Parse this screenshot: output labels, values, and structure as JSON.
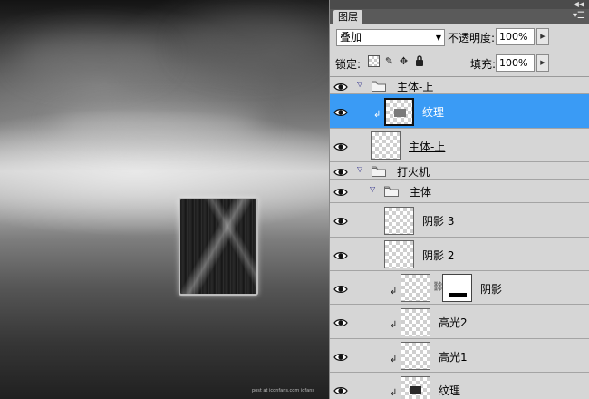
{
  "canvas": {
    "watermark": "post at iconfans.com  idfans"
  },
  "panel": {
    "tab_label": "图层",
    "blend_mode": "叠加",
    "opacity_label": "不透明度:",
    "opacity_value": "100%",
    "lock_label": "锁定:",
    "fill_label": "填充:",
    "fill_value": "100%"
  },
  "layers": [
    {
      "name": "主体-上",
      "kind": "group",
      "indent": 0,
      "expanded": true
    },
    {
      "name": "纹理",
      "kind": "layer",
      "indent": 1,
      "clipped": true,
      "selected": true
    },
    {
      "name": "主体-上",
      "kind": "layer",
      "indent": 0,
      "underlined": true
    },
    {
      "name": "打火机",
      "kind": "group",
      "indent": 0,
      "expanded": true
    },
    {
      "name": "主体",
      "kind": "group",
      "indent": 1,
      "expanded": true
    },
    {
      "name": "阴影 3",
      "kind": "layer",
      "indent": 1
    },
    {
      "name": "阴影 2",
      "kind": "layer",
      "indent": 1
    },
    {
      "name": "阴影",
      "kind": "layer",
      "indent": 2,
      "clipped": true,
      "has_mask": true
    },
    {
      "name": "高光2",
      "kind": "layer",
      "indent": 2,
      "clipped": true
    },
    {
      "name": "高光1",
      "kind": "layer",
      "indent": 2,
      "clipped": true
    },
    {
      "name": "纹理",
      "kind": "layer",
      "indent": 2,
      "clipped": true
    }
  ],
  "icons": {
    "eye": "eye-icon",
    "folder": "folder-icon",
    "expand": "triangle-down-icon",
    "clip": "clipping-arrow-icon",
    "chain": "link-icon"
  },
  "colors": {
    "selected_row": "#3a9bf5",
    "panel_bg": "#d6d6d6"
  }
}
